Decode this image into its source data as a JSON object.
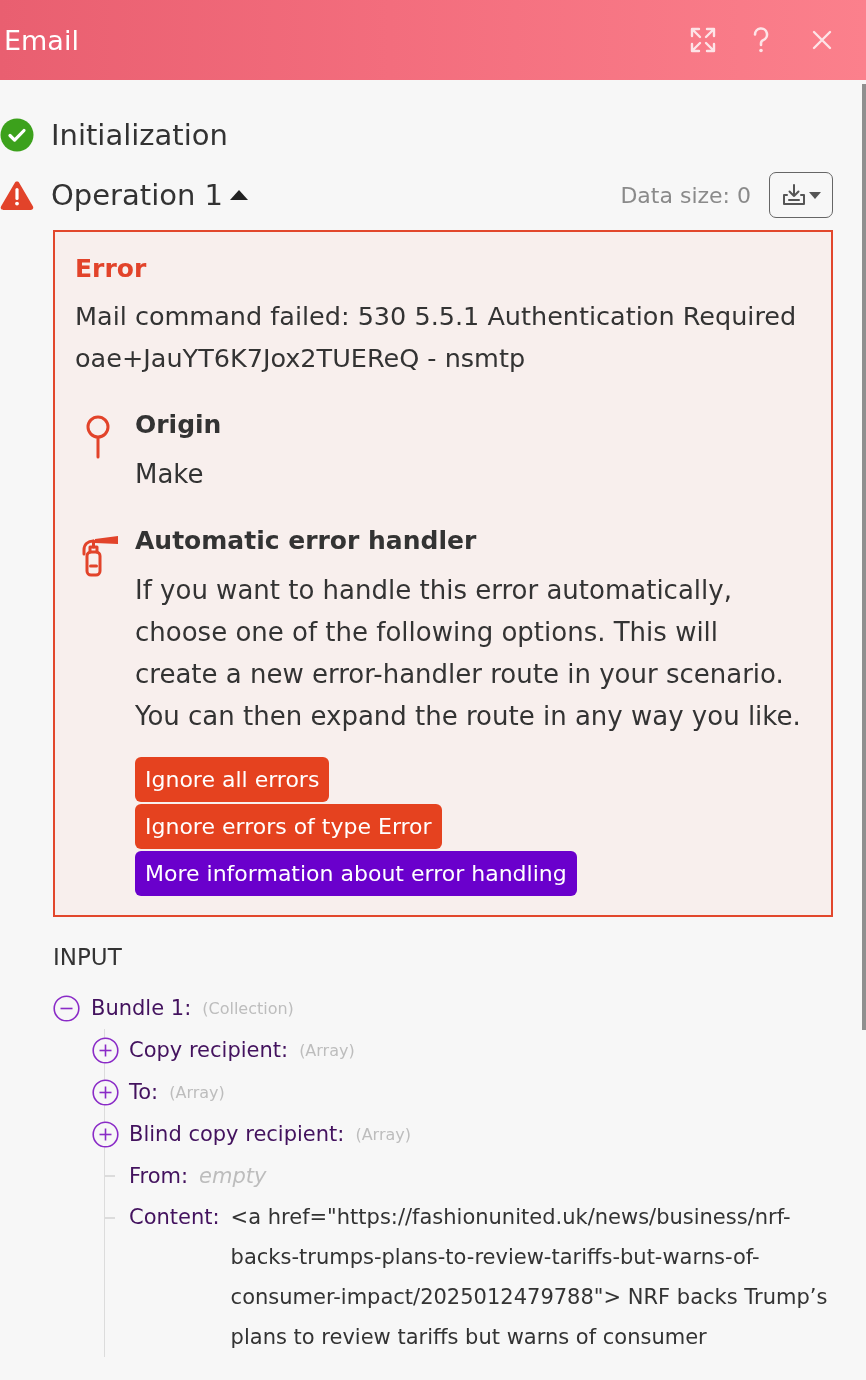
{
  "window": {
    "title": "Email"
  },
  "steps": [
    {
      "kind": "success",
      "label": "Initialization"
    },
    {
      "kind": "error",
      "label": "Operation 1",
      "expanded": true,
      "data_size": "Data size: 0"
    }
  ],
  "error": {
    "title": "Error",
    "message": "Mail command failed: 530 5.5.1 Authentication Required oae+JauYT6K7Jox2TUEReQ - nsmtp",
    "sections": [
      {
        "kind": "origin",
        "title": "Origin",
        "text": "Make"
      },
      {
        "kind": "handler",
        "title": "Automatic error handler",
        "text": "If you want to handle this error automatically, choose one of the following options. This will create a new error-handler route in your scenario. You can then expand the route in any way you like.",
        "buttons": [
          {
            "kind": "ignore",
            "label": "Ignore all errors"
          },
          {
            "kind": "ignore",
            "label": "Ignore errors of type Error"
          },
          {
            "kind": "info",
            "label": "More information about error handling"
          }
        ]
      }
    ]
  },
  "input": {
    "title": "INPUT",
    "tree": [
      {
        "kind": "node",
        "label": "Bundle 1:",
        "type": "(Collection)",
        "expanded": true,
        "children": [
          {
            "kind": "node",
            "label": "Copy recipient:",
            "type": "(Array)",
            "expanded": false
          },
          {
            "kind": "node",
            "label": "To:",
            "type": "(Array)",
            "expanded": false
          },
          {
            "kind": "node",
            "label": "Blind copy recipient:",
            "type": "(Array)",
            "expanded": false
          },
          {
            "kind": "empty",
            "label": "From:",
            "value": "empty"
          },
          {
            "kind": "value",
            "label": "Content:",
            "value": "<a href=\"https://fashionunited.uk/news/business/nrf-backs-trumps-plans-to-review-tariffs-but-warns-of-consumer-impact/2025012479788\"> NRF backs Trump’s plans to review tariffs but warns of consumer"
          }
        ]
      }
    ]
  }
}
